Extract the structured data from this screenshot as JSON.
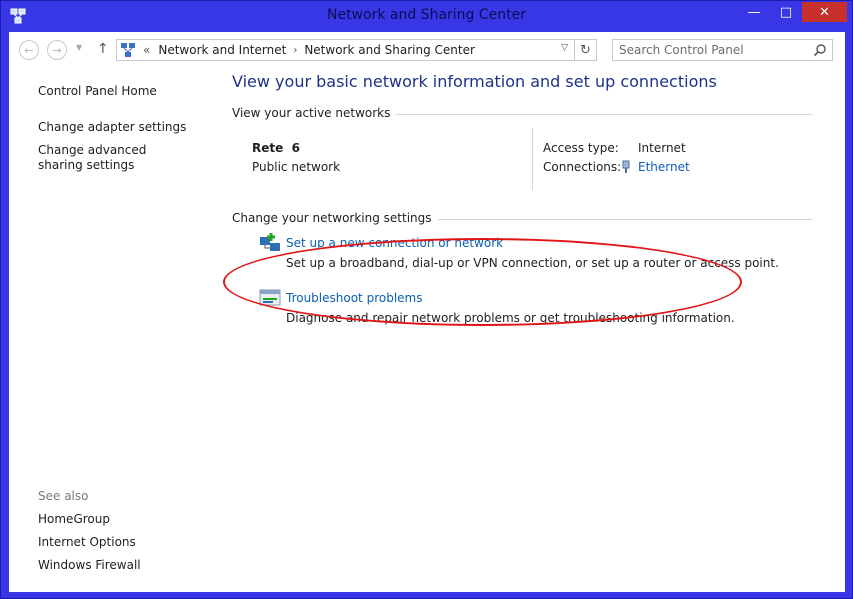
{
  "window": {
    "title": "Network and Sharing Center",
    "controls": {
      "minimize": "—",
      "maximize": "□",
      "close": "✕"
    }
  },
  "navbar": {
    "back_icon": "arrow-left-icon",
    "forward_icon": "arrow-right-icon",
    "up_icon": "arrow-up-icon",
    "breadcrumb_prefix": "«",
    "breadcrumbs": [
      "Network and Internet",
      "Network and Sharing Center"
    ],
    "separator": "›",
    "search_placeholder": "Search Control Panel"
  },
  "left_pane": {
    "links": [
      "Control Panel Home",
      "Change adapter settings",
      "Change advanced sharing settings"
    ],
    "see_also_label": "See also",
    "see_also": [
      "HomeGroup",
      "Internet Options",
      "Windows Firewall"
    ]
  },
  "main": {
    "heading": "View your basic network information and set up connections",
    "active_networks_title": "View your active networks",
    "network": {
      "name": "Rete  6",
      "category": "Public network",
      "access_type_label": "Access type:",
      "access_type": "Internet",
      "connections_label": "Connections:",
      "connection": "Ethernet"
    },
    "settings_title": "Change your networking settings",
    "tasks": [
      {
        "link": "Set up a new connection or network",
        "description": "Set up a broadband, dial-up or VPN connection, or set up a router or access point.",
        "icon": "new-connection-icon"
      },
      {
        "link": "Troubleshoot problems",
        "description": "Diagnose and repair network problems or get troubleshooting information.",
        "icon": "troubleshoot-icon"
      }
    ]
  },
  "colors": {
    "frame": "#3737e6",
    "link": "#0b5fb3",
    "heading": "#1e3287",
    "annotation": "#e01515",
    "close_button": "#c7302b"
  }
}
